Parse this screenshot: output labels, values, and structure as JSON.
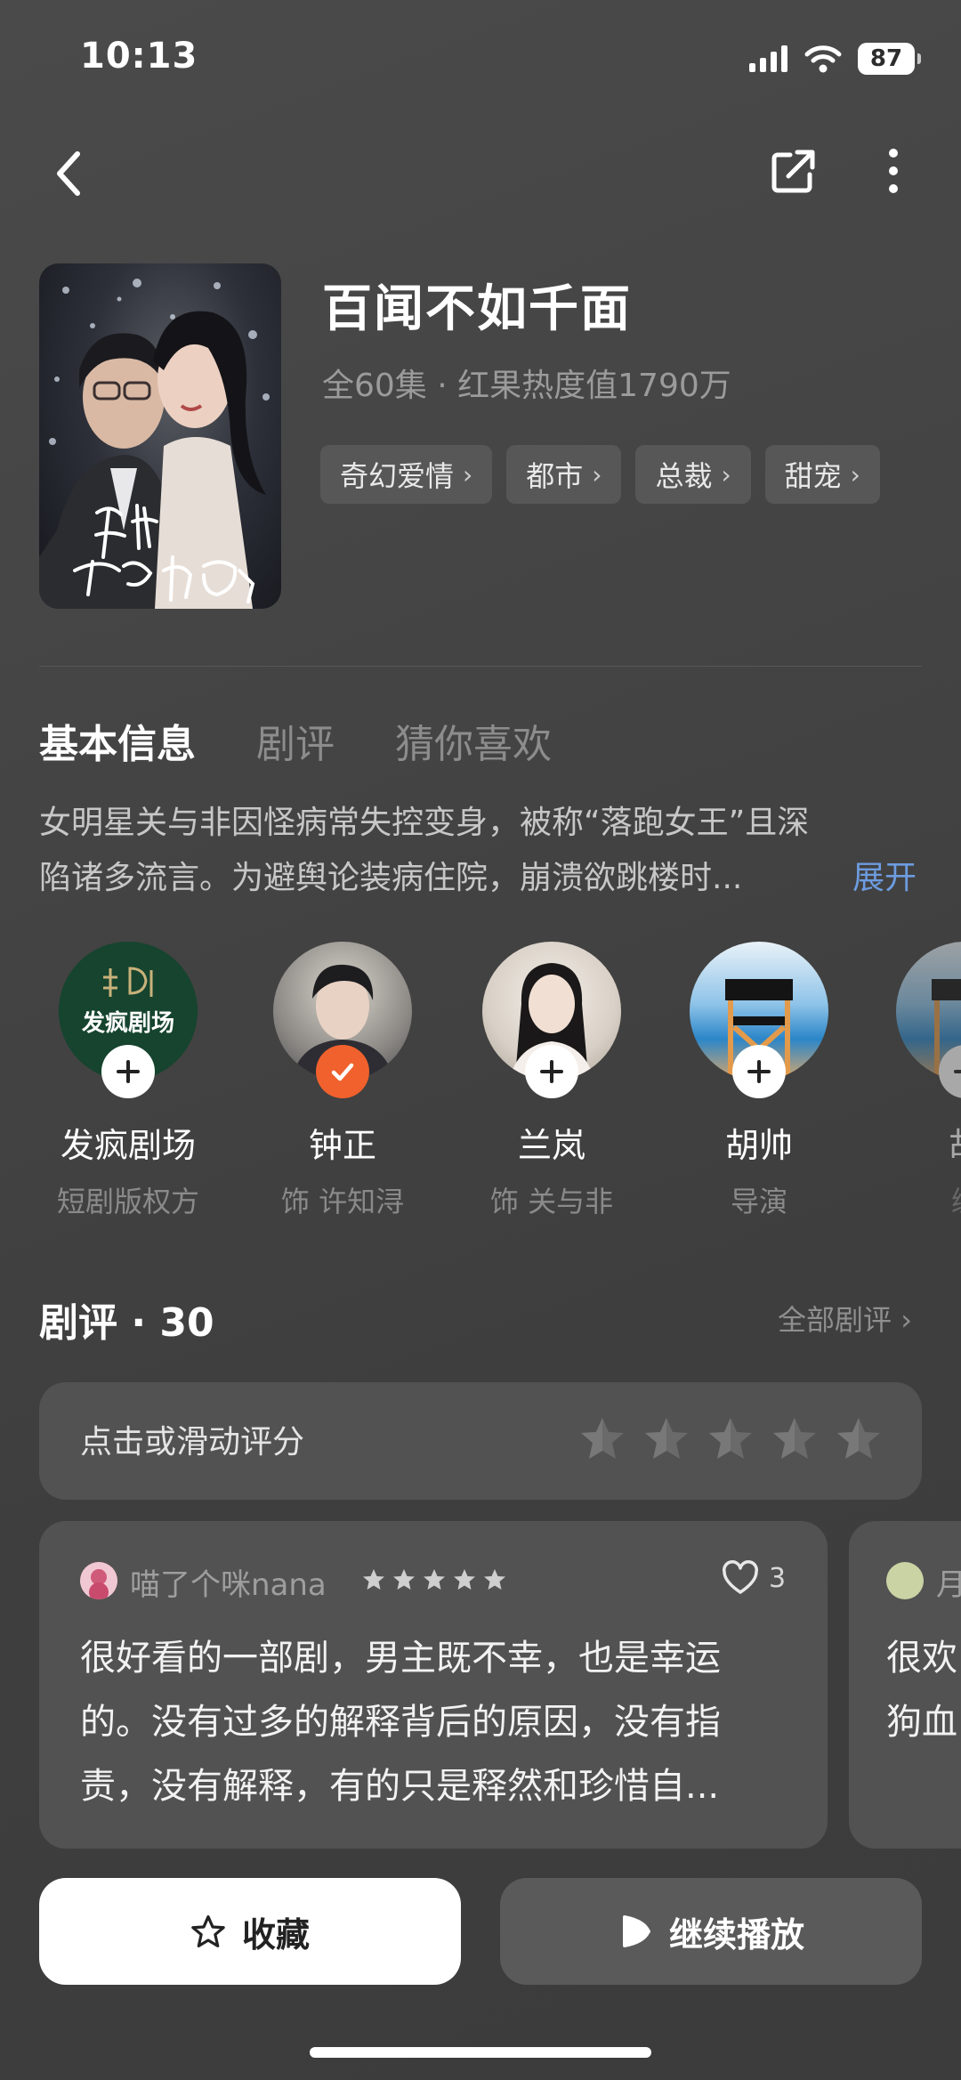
{
  "status_bar": {
    "time": "10:13",
    "battery": "87"
  },
  "header": {
    "title": "百闻不如千面",
    "meta": "全60集 · 红果热度值1790万",
    "tags": [
      "奇幻爱情",
      "都市",
      "总裁",
      "甜宠"
    ],
    "poster_art": "百闻不如千面"
  },
  "tabs": [
    {
      "label": "基本信息",
      "active": true
    },
    {
      "label": "剧评",
      "active": false
    },
    {
      "label": "猜你喜欢",
      "active": false
    }
  ],
  "synopsis": {
    "line1": "女明星关与非因怪病常失控变身，被称“落跑女王”且深",
    "line2": "陷诸多流言。为避舆论装病住院，崩溃欲跳楼时...",
    "expand_label": "展开"
  },
  "people": [
    {
      "name": "发疯剧场",
      "role": "短剧版权方",
      "followed": false,
      "logo_text": "发疯剧场"
    },
    {
      "name": "钟正",
      "role": "饰 许知浔",
      "followed": true
    },
    {
      "name": "兰岚",
      "role": "饰 关与非",
      "followed": false
    },
    {
      "name": "胡帅",
      "role": "导演",
      "followed": false
    },
    {
      "name": "胡",
      "role": "编",
      "followed": false
    }
  ],
  "reviews": {
    "title": "剧评 · 30",
    "all_label": "全部剧评",
    "rate_prompt": "点击或滑动评分",
    "items": [
      {
        "user": "喵了个咪nana",
        "stars": 5,
        "likes": "3",
        "line1": "很好看的一部剧，男主既不幸，也是幸运",
        "line2": "的。没有过多的解释背后的原因，没有指",
        "line3": "责，没有解释，有的只是释然和珍惜自..."
      },
      {
        "user": "月",
        "line1": "很欢",
        "line2": "狗血"
      }
    ]
  },
  "actions": {
    "favorite_label": "收藏",
    "play_label": "继续播放"
  }
}
